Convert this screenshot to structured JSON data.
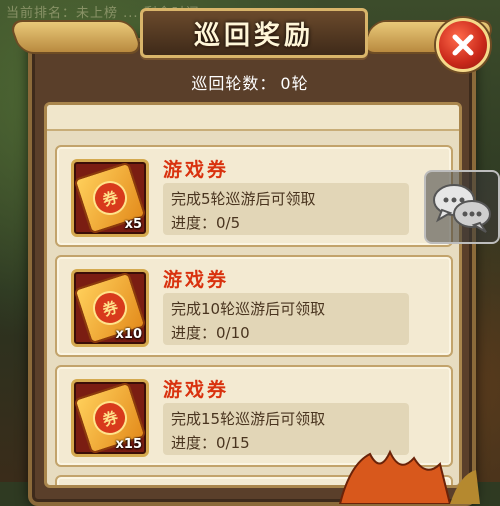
{
  "background": {
    "faint_text": "当前排名：未上榜 ... 剩余时间："
  },
  "header": {
    "title": "巡回奖励"
  },
  "round_info": {
    "label": "巡回轮数：",
    "value": "0轮"
  },
  "rewards": [
    {
      "title": "游戏券",
      "seal": "券",
      "quantity": "x5",
      "requirement": "完成5轮巡游后可领取",
      "progress_label": "进度：",
      "progress_value": "0/5",
      "progress_fraction": 0
    },
    {
      "title": "游戏券",
      "seal": "券",
      "quantity": "x10",
      "requirement": "完成10轮巡游后可领取",
      "progress_label": "进度：",
      "progress_value": "0/10",
      "progress_fraction": 0
    },
    {
      "title": "游戏券",
      "seal": "券",
      "quantity": "x15",
      "requirement": "完成15轮巡游后可领取",
      "progress_label": "进度：",
      "progress_value": "0/15",
      "progress_fraction": 0
    }
  ],
  "icons": {
    "close": "close-icon",
    "chat": "chat-bubbles-icon",
    "ticket": "game-ticket-icon"
  },
  "colors": {
    "title_text": "#fff6d8",
    "reward_title": "#d9320f",
    "close_button": "#c9281a",
    "panel_brown": "#5a3f2a",
    "card_bg": "#f3ead2"
  }
}
